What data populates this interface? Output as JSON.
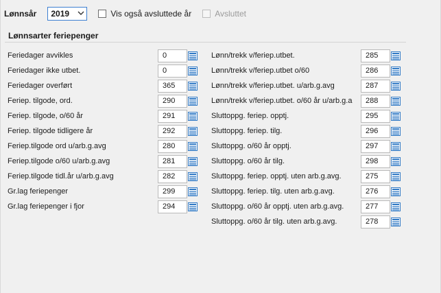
{
  "header": {
    "year_label": "Lønnsår",
    "year_value": "2019",
    "show_closed_label": "Vis også avsluttede år",
    "closed_label": "Avsluttet"
  },
  "section": {
    "title": "Lønnsarter feriepenger"
  },
  "left_fields": [
    {
      "label": "Feriedager avvikles",
      "value": "0"
    },
    {
      "label": "Feriedager ikke utbet.",
      "value": "0"
    },
    {
      "label": "Feriedager overført",
      "value": "365"
    },
    {
      "label": "Feriep. tilgode, ord.",
      "value": "290"
    },
    {
      "label": "Feriep. tilgode, o/60 år",
      "value": "291"
    },
    {
      "label": "Feriep. tilgode tidligere år",
      "value": "292"
    },
    {
      "label": "Feriep.tilgode ord u/arb.g.avg",
      "value": "280"
    },
    {
      "label": "Feriep.tilgode o/60 u/arb.g.avg",
      "value": "281"
    },
    {
      "label": "Feriep.tilgode tidl.år u/arb.g.avg",
      "value": "282"
    },
    {
      "label": "Gr.lag feriepenger",
      "value": "299"
    },
    {
      "label": "Gr.lag feriepenger i fjor",
      "value": "294"
    }
  ],
  "right_fields": [
    {
      "label": "Lønn/trekk v/feriep.utbet.",
      "value": "285"
    },
    {
      "label": "Lønn/trekk v/feriep.utbet o/60",
      "value": "286"
    },
    {
      "label": "Lønn/trekk v/feriep.utbet. u/arb.g.avg",
      "value": "287"
    },
    {
      "label": "Lønn/trekk v/feriep.utbet. o/60 år u/arb.g.a",
      "value": "288"
    },
    {
      "label": "Sluttoppg. feriep. opptj.",
      "value": "295"
    },
    {
      "label": "Sluttoppg. feriep. tilg.",
      "value": "296"
    },
    {
      "label": "Sluttoppg. o/60 år opptj.",
      "value": "297"
    },
    {
      "label": "Sluttoppg. o/60 år tilg.",
      "value": "298"
    },
    {
      "label": "Sluttoppg. feriep. opptj. uten arb.g.avg.",
      "value": "275"
    },
    {
      "label": "Sluttoppg. feriep. tilg. uten arb.g.avg.",
      "value": "276"
    },
    {
      "label": "Sluttoppg. o/60 år opptj. uten arb.g.avg.",
      "value": "277"
    },
    {
      "label": "Sluttoppg. o/60 år tilg. uten arb.g.avg.",
      "value": "278"
    }
  ],
  "icons": {
    "lookup": "list-lookup-icon",
    "dropdown": "chevron-down-icon"
  },
  "colors": {
    "accent": "#3c7fd1",
    "lookup_icon": "#2f78c4"
  }
}
